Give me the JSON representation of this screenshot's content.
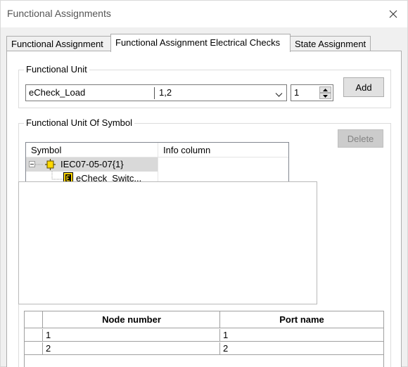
{
  "window": {
    "title": "Functional Assignments"
  },
  "tabs": [
    {
      "label": "Functional Assignment",
      "active": false
    },
    {
      "label": "Functional Assignment Electrical Checks",
      "active": true
    },
    {
      "label": "State Assignment",
      "active": false
    }
  ],
  "functional_unit": {
    "legend": "Functional Unit",
    "combo_left": "eCheck_Load",
    "combo_right": "1,2",
    "spin_value": "1",
    "add_label": "Add"
  },
  "unit_of_symbol": {
    "legend": "Functional Unit Of Symbol",
    "delete_label": "Delete",
    "columns": [
      "Symbol",
      "Info column"
    ],
    "rows": [
      {
        "label": "IEC07-05-07{1}",
        "selected": true,
        "expander": "minus",
        "icon": "symbol-icon"
      },
      {
        "label": "eCheck_Switc...",
        "selected": false,
        "expander": "none",
        "icon": "check-function-icon"
      }
    ]
  },
  "node_grid": {
    "columns": [
      "Node number",
      "Port name"
    ],
    "rows": [
      [
        "1",
        "1"
      ],
      [
        "2",
        "2"
      ]
    ]
  },
  "colors": {
    "window_bg": "#f0f0f0",
    "selection": "#d9d9d9",
    "icon_yellow": "#ffd800"
  }
}
